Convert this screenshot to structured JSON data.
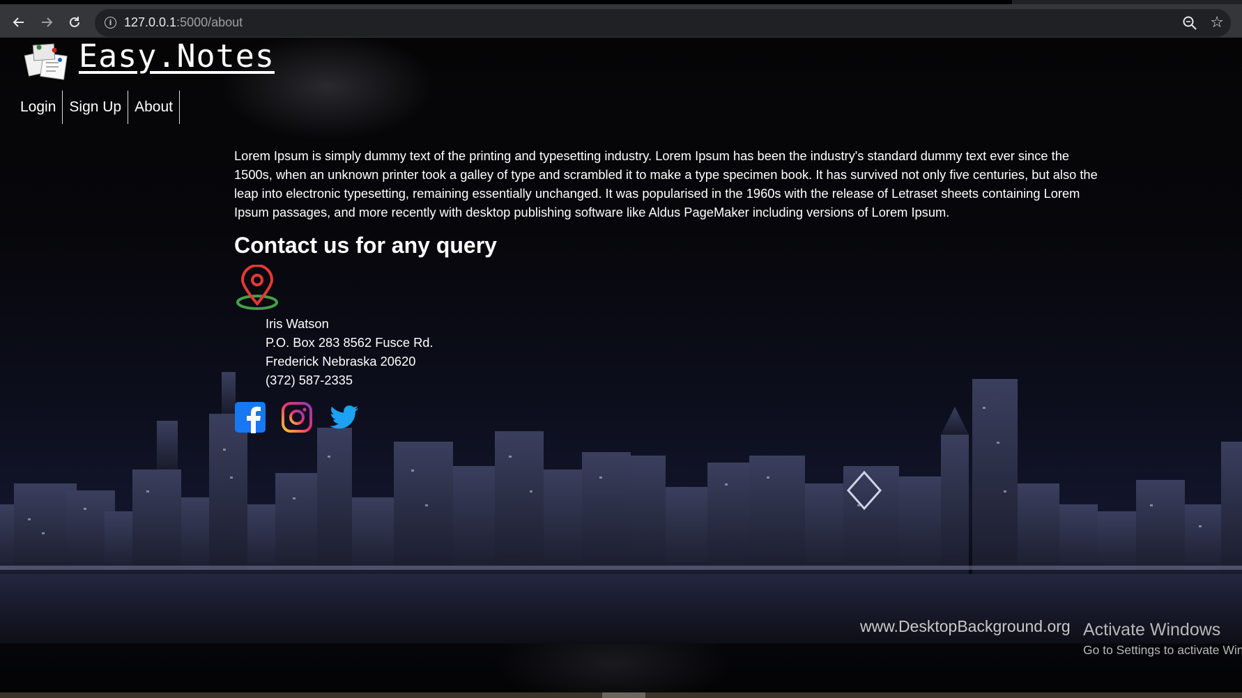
{
  "browser": {
    "url_host": "127.0.0.1",
    "url_rest": ":5000/about",
    "back_icon": "arrow-left-icon",
    "forward_icon": "arrow-right-icon",
    "reload_icon": "reload-icon",
    "site_info_icon": "info-icon",
    "zoom_icon": "zoom-icon",
    "bookmark_icon": "star-icon"
  },
  "site": {
    "title": "Easy.Notes",
    "logo_icon": "notes-logo-icon"
  },
  "nav": {
    "items": [
      {
        "label": "Login"
      },
      {
        "label": "Sign Up"
      },
      {
        "label": "About"
      }
    ]
  },
  "about": {
    "paragraph": "Lorem Ipsum is simply dummy text of the printing and typesetting industry. Lorem Ipsum has been the industry's standard dummy text ever since the 1500s, when an unknown printer took a galley of type and scrambled it to make a type specimen book. It has survived not only five centuries, but also the leap into electronic typesetting, remaining essentially unchanged. It was popularised in the 1960s with the release of Letraset sheets containing Lorem Ipsum passages, and more recently with desktop publishing software like Aldus PageMaker including versions of Lorem Ipsum."
  },
  "contact": {
    "heading": "Contact us for any query",
    "location_icon": "map-pin-icon",
    "address": {
      "name": "Iris Watson",
      "line1": "P.O. Box 283 8562 Fusce Rd.",
      "line2": "Frederick Nebraska 20620",
      "phone": "(372) 587-2335"
    },
    "social": [
      "facebook-icon",
      "instagram-icon",
      "twitter-icon"
    ]
  },
  "background": {
    "watermark": "www.DesktopBackground.org"
  },
  "os_overlay": {
    "title": "Activate Windows",
    "subtitle": "Go to Settings to activate Windows."
  },
  "colors": {
    "chrome_bg": "#35363a",
    "omnibox_bg": "#202124",
    "page_text": "#ffffff",
    "pin_red": "#e53935",
    "pin_green": "#43a047",
    "facebook_blue": "#1877f2",
    "twitter_blue": "#1da1f2"
  }
}
